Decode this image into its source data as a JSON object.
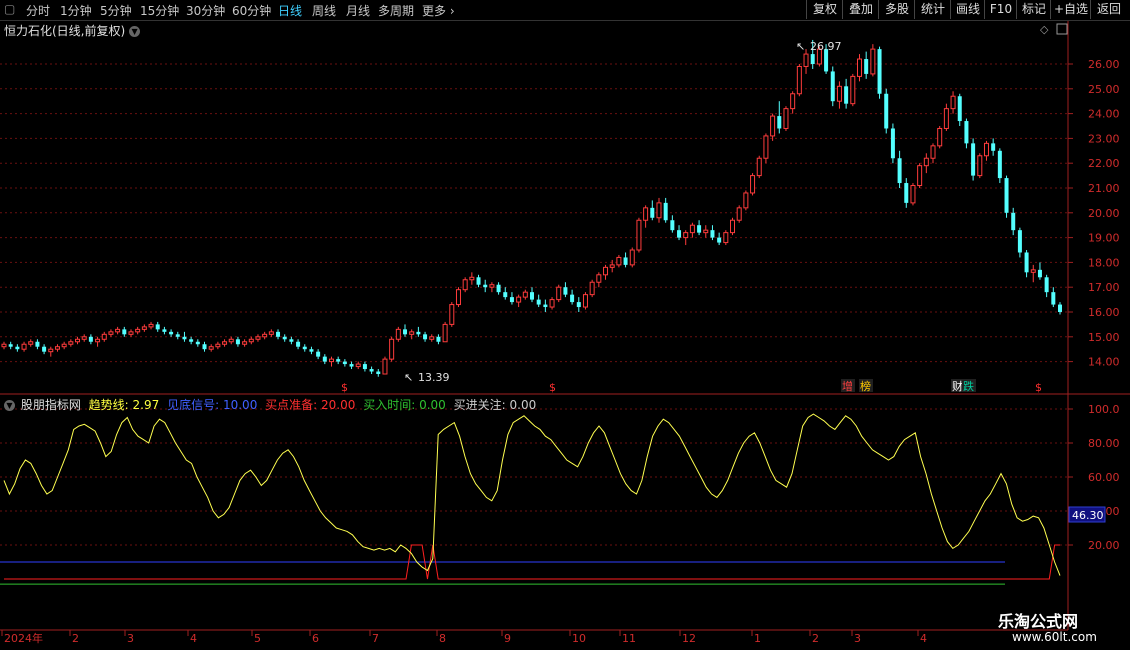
{
  "toolbar": {
    "nav_box": "▢",
    "periods": [
      "分时",
      "1分钟",
      "5分钟",
      "15分钟",
      "30分钟",
      "60分钟",
      "日线",
      "周线",
      "月线",
      "多周期",
      "更多 ›"
    ],
    "active_period": 6,
    "right_buttons": [
      "复权",
      "叠加",
      "多股",
      "统计",
      "画线",
      "F10",
      "标记",
      "+自选",
      "返回"
    ]
  },
  "main_chart": {
    "title": "恒力石化(日线,前复权)",
    "max_label": "26.97",
    "min_label": "13.39",
    "price_axis": [
      "26.00",
      "25.00",
      "24.00",
      "23.00",
      "22.00",
      "21.00",
      "20.00",
      "19.00",
      "18.00",
      "17.00",
      "16.00",
      "15.00",
      "14.00"
    ],
    "markers": [
      {
        "text": "$",
        "color": "#ff3030"
      },
      {
        "text": "$",
        "color": "#ff3030"
      },
      {
        "text": "增",
        "color": "#ff4040"
      },
      {
        "text": "榜",
        "color": "#ffcc00"
      },
      {
        "text": "财",
        "color": "#ffffff"
      },
      {
        "text": "跌",
        "color": "#00d0a0"
      },
      {
        "text": "$",
        "color": "#ff3030"
      }
    ]
  },
  "indicator": {
    "name": "股朋指标网",
    "trend": {
      "label": "趋势线:",
      "value": "2.97",
      "color": "#ffff40"
    },
    "bottom": {
      "label": "见底信号:",
      "value": "10.00",
      "color": "#4060ff"
    },
    "ready": {
      "label": "买点准备:",
      "value": "20.00",
      "color": "#ff3030"
    },
    "buy_time": {
      "label": "买入时间:",
      "value": "0.00",
      "color": "#30c030"
    },
    "attention": {
      "label": "买进关注:",
      "value": "0.00",
      "color": "#cccccc"
    },
    "axis": [
      "100.0",
      "80.00",
      "60.00",
      "40.00",
      "20.00"
    ],
    "current_value": "46.30",
    "trend_series": [
      58,
      50,
      56,
      65,
      70,
      68,
      62,
      55,
      50,
      52,
      60,
      68,
      76,
      88,
      90,
      91,
      89,
      87,
      80,
      72,
      75,
      85,
      92,
      95,
      88,
      84,
      82,
      80,
      90,
      94,
      92,
      86,
      80,
      75,
      70,
      68,
      60,
      54,
      48,
      40,
      36,
      38,
      42,
      50,
      58,
      62,
      64,
      60,
      55,
      58,
      64,
      70,
      74,
      76,
      72,
      66,
      58,
      52,
      46,
      40,
      36,
      33,
      30,
      29,
      28,
      26,
      22,
      19,
      18,
      17,
      18,
      17,
      18,
      16,
      20,
      18,
      15,
      10,
      7,
      5,
      12,
      85,
      88,
      90,
      92,
      84,
      72,
      62,
      56,
      52,
      48,
      46,
      52,
      70,
      85,
      92,
      94,
      96,
      93,
      90,
      88,
      84,
      82,
      78,
      74,
      70,
      68,
      66,
      72,
      80,
      86,
      90,
      86,
      78,
      70,
      62,
      56,
      52,
      50,
      58,
      72,
      84,
      90,
      94,
      92,
      88,
      84,
      78,
      72,
      66,
      60,
      54,
      50,
      48,
      52,
      58,
      66,
      74,
      80,
      84,
      86,
      80,
      72,
      64,
      58,
      56,
      54,
      62,
      76,
      90,
      95,
      97,
      95,
      93,
      90,
      88,
      92,
      96,
      94,
      90,
      84,
      80,
      76,
      74,
      72,
      70,
      72,
      78,
      82,
      84,
      86,
      72,
      62,
      50,
      40,
      30,
      22,
      18,
      20,
      24,
      28,
      34,
      40,
      46,
      50,
      56,
      62,
      56,
      44,
      36,
      34,
      35,
      37,
      36,
      30,
      20,
      10,
      2
    ],
    "red_step_series": [
      0,
      0,
      0,
      0,
      0,
      0,
      0,
      0,
      0,
      0,
      0,
      0,
      0,
      0,
      0,
      0,
      0,
      0,
      0,
      0,
      0,
      0,
      0,
      0,
      0,
      0,
      0,
      0,
      0,
      0,
      0,
      0,
      0,
      0,
      0,
      0,
      0,
      0,
      0,
      0,
      0,
      0,
      0,
      0,
      0,
      0,
      0,
      0,
      0,
      0,
      0,
      0,
      0,
      0,
      0,
      0,
      0,
      0,
      0,
      0,
      0,
      0,
      0,
      0,
      0,
      0,
      0,
      0,
      0,
      0,
      0,
      0,
      0,
      0,
      0,
      0,
      20,
      20,
      20,
      0,
      20,
      0,
      0,
      0,
      0,
      0,
      0,
      0,
      0,
      0,
      0,
      0,
      0,
      0,
      0,
      0,
      0,
      0,
      0,
      0,
      0,
      0,
      0,
      0,
      0,
      0,
      0,
      0,
      0,
      0,
      0,
      0,
      0,
      0,
      0,
      0,
      0,
      0,
      0,
      0,
      0,
      0,
      0,
      0,
      0,
      0,
      0,
      0,
      0,
      0,
      0,
      0,
      0,
      0,
      0,
      0,
      0,
      0,
      0,
      0,
      0,
      0,
      0,
      0,
      0,
      0,
      0,
      0,
      0,
      0,
      0,
      0,
      0,
      0,
      0,
      0,
      0,
      0,
      0,
      0,
      0,
      0,
      0,
      0,
      0,
      0,
      0,
      0,
      0,
      0,
      0,
      0,
      0,
      0,
      0,
      0,
      0,
      0,
      0,
      0,
      0,
      0,
      0,
      0,
      0,
      0,
      0,
      0,
      0,
      0,
      0,
      0,
      0,
      0,
      0,
      0,
      20,
      20
    ]
  },
  "xaxis": [
    "2024年",
    "2",
    "3",
    "4",
    "5",
    "6",
    "7",
    "8",
    "9",
    "10",
    "11",
    "12",
    "1",
    "2",
    "3",
    "4"
  ],
  "candles": [
    [
      14.6,
      14.8,
      14.5,
      14.7
    ],
    [
      14.7,
      14.8,
      14.5,
      14.6
    ],
    [
      14.6,
      14.7,
      14.4,
      14.5
    ],
    [
      14.5,
      14.8,
      14.4,
      14.7
    ],
    [
      14.7,
      14.9,
      14.6,
      14.8
    ],
    [
      14.8,
      14.9,
      14.5,
      14.6
    ],
    [
      14.6,
      14.7,
      14.3,
      14.4
    ],
    [
      14.4,
      14.6,
      14.2,
      14.5
    ],
    [
      14.5,
      14.7,
      14.4,
      14.6
    ],
    [
      14.6,
      14.8,
      14.5,
      14.7
    ],
    [
      14.7,
      14.9,
      14.6,
      14.8
    ],
    [
      14.8,
      15.0,
      14.7,
      14.9
    ],
    [
      14.9,
      15.1,
      14.8,
      15.0
    ],
    [
      15.0,
      15.1,
      14.7,
      14.8
    ],
    [
      14.8,
      15.0,
      14.6,
      14.9
    ],
    [
      14.9,
      15.2,
      14.8,
      15.1
    ],
    [
      15.1,
      15.3,
      15.0,
      15.2
    ],
    [
      15.2,
      15.4,
      15.1,
      15.3
    ],
    [
      15.3,
      15.4,
      15.0,
      15.1
    ],
    [
      15.1,
      15.3,
      15.0,
      15.2
    ],
    [
      15.2,
      15.4,
      15.1,
      15.3
    ],
    [
      15.3,
      15.5,
      15.2,
      15.4
    ],
    [
      15.4,
      15.6,
      15.3,
      15.5
    ],
    [
      15.5,
      15.6,
      15.2,
      15.3
    ],
    [
      15.3,
      15.4,
      15.1,
      15.2
    ],
    [
      15.2,
      15.3,
      15.0,
      15.1
    ],
    [
      15.1,
      15.2,
      14.9,
      15.0
    ],
    [
      15.0,
      15.2,
      14.8,
      14.9
    ],
    [
      14.9,
      15.0,
      14.7,
      14.8
    ],
    [
      14.8,
      14.9,
      14.6,
      14.7
    ],
    [
      14.7,
      14.8,
      14.4,
      14.5
    ],
    [
      14.5,
      14.7,
      14.4,
      14.6
    ],
    [
      14.6,
      14.8,
      14.5,
      14.7
    ],
    [
      14.7,
      14.9,
      14.6,
      14.8
    ],
    [
      14.8,
      15.0,
      14.7,
      14.9
    ],
    [
      14.9,
      15.0,
      14.6,
      14.7
    ],
    [
      14.7,
      14.9,
      14.6,
      14.8
    ],
    [
      14.8,
      15.0,
      14.7,
      14.9
    ],
    [
      14.9,
      15.1,
      14.8,
      15.0
    ],
    [
      15.0,
      15.2,
      14.9,
      15.1
    ],
    [
      15.1,
      15.3,
      15.0,
      15.2
    ],
    [
      15.2,
      15.3,
      14.9,
      15.0
    ],
    [
      15.0,
      15.1,
      14.8,
      14.9
    ],
    [
      14.9,
      15.0,
      14.7,
      14.8
    ],
    [
      14.8,
      14.9,
      14.5,
      14.6
    ],
    [
      14.6,
      14.7,
      14.4,
      14.5
    ],
    [
      14.5,
      14.6,
      14.3,
      14.4
    ],
    [
      14.4,
      14.5,
      14.1,
      14.2
    ],
    [
      14.2,
      14.3,
      13.9,
      14.0
    ],
    [
      14.0,
      14.2,
      13.8,
      14.1
    ],
    [
      14.1,
      14.2,
      13.9,
      14.0
    ],
    [
      14.0,
      14.1,
      13.8,
      13.9
    ],
    [
      13.9,
      14.0,
      13.7,
      13.8
    ],
    [
      13.8,
      14.0,
      13.7,
      13.9
    ],
    [
      13.9,
      14.0,
      13.6,
      13.7
    ],
    [
      13.7,
      13.8,
      13.5,
      13.6
    ],
    [
      13.6,
      13.7,
      13.39,
      13.5
    ],
    [
      13.5,
      14.2,
      13.5,
      14.1
    ],
    [
      14.1,
      15.0,
      14.0,
      14.9
    ],
    [
      14.9,
      15.4,
      14.8,
      15.3
    ],
    [
      15.3,
      15.5,
      15.0,
      15.1
    ],
    [
      15.1,
      15.3,
      14.9,
      15.2
    ],
    [
      15.2,
      15.4,
      15.0,
      15.1
    ],
    [
      15.1,
      15.2,
      14.8,
      14.9
    ],
    [
      14.9,
      15.1,
      14.8,
      15.0
    ],
    [
      15.0,
      15.1,
      14.7,
      14.8
    ],
    [
      14.8,
      15.6,
      14.8,
      15.5
    ],
    [
      15.5,
      16.4,
      15.4,
      16.3
    ],
    [
      16.3,
      17.0,
      16.2,
      16.9
    ],
    [
      16.9,
      17.4,
      16.8,
      17.3
    ],
    [
      17.3,
      17.6,
      17.1,
      17.4
    ],
    [
      17.4,
      17.5,
      17.0,
      17.1
    ],
    [
      17.1,
      17.3,
      16.8,
      17.0
    ],
    [
      17.0,
      17.2,
      16.8,
      17.1
    ],
    [
      17.1,
      17.2,
      16.7,
      16.8
    ],
    [
      16.8,
      17.0,
      16.5,
      16.6
    ],
    [
      16.6,
      16.8,
      16.3,
      16.4
    ],
    [
      16.4,
      16.7,
      16.2,
      16.6
    ],
    [
      16.6,
      16.9,
      16.5,
      16.8
    ],
    [
      16.8,
      17.0,
      16.4,
      16.5
    ],
    [
      16.5,
      16.7,
      16.2,
      16.3
    ],
    [
      16.3,
      16.5,
      16.0,
      16.2
    ],
    [
      16.2,
      16.6,
      16.1,
      16.5
    ],
    [
      16.5,
      17.1,
      16.4,
      17.0
    ],
    [
      17.0,
      17.2,
      16.6,
      16.7
    ],
    [
      16.7,
      16.9,
      16.3,
      16.4
    ],
    [
      16.4,
      16.6,
      16.0,
      16.2
    ],
    [
      16.2,
      16.8,
      16.1,
      16.7
    ],
    [
      16.7,
      17.3,
      16.6,
      17.2
    ],
    [
      17.2,
      17.6,
      17.0,
      17.5
    ],
    [
      17.5,
      17.9,
      17.3,
      17.8
    ],
    [
      17.8,
      18.1,
      17.6,
      17.9
    ],
    [
      17.9,
      18.3,
      17.8,
      18.2
    ],
    [
      18.2,
      18.4,
      17.8,
      17.9
    ],
    [
      17.9,
      18.6,
      17.8,
      18.5
    ],
    [
      18.5,
      19.8,
      18.4,
      19.7
    ],
    [
      19.7,
      20.3,
      19.4,
      20.2
    ],
    [
      20.2,
      20.5,
      19.7,
      19.8
    ],
    [
      19.8,
      20.6,
      19.6,
      20.4
    ],
    [
      20.4,
      20.6,
      19.6,
      19.7
    ],
    [
      19.7,
      19.9,
      19.2,
      19.3
    ],
    [
      19.3,
      19.5,
      18.9,
      19.0
    ],
    [
      19.0,
      19.3,
      18.7,
      19.2
    ],
    [
      19.2,
      19.6,
      19.0,
      19.5
    ],
    [
      19.5,
      19.7,
      19.1,
      19.2
    ],
    [
      19.2,
      19.5,
      19.0,
      19.3
    ],
    [
      19.3,
      19.5,
      18.9,
      19.0
    ],
    [
      19.0,
      19.2,
      18.7,
      18.8
    ],
    [
      18.8,
      19.3,
      18.7,
      19.2
    ],
    [
      19.2,
      19.8,
      19.1,
      19.7
    ],
    [
      19.7,
      20.3,
      19.6,
      20.2
    ],
    [
      20.2,
      20.9,
      20.1,
      20.8
    ],
    [
      20.8,
      21.6,
      20.7,
      21.5
    ],
    [
      21.5,
      22.3,
      21.4,
      22.2
    ],
    [
      22.2,
      23.2,
      22.0,
      23.1
    ],
    [
      23.1,
      24.0,
      22.9,
      23.9
    ],
    [
      23.9,
      24.5,
      23.2,
      23.4
    ],
    [
      23.4,
      24.3,
      23.3,
      24.2
    ],
    [
      24.2,
      24.9,
      24.0,
      24.8
    ],
    [
      24.8,
      26.0,
      24.7,
      25.9
    ],
    [
      25.9,
      26.6,
      25.6,
      26.4
    ],
    [
      26.4,
      26.97,
      25.8,
      26.0
    ],
    [
      26.0,
      26.7,
      25.9,
      26.6
    ],
    [
      26.6,
      26.8,
      25.6,
      25.7
    ],
    [
      25.7,
      25.9,
      24.3,
      24.5
    ],
    [
      24.5,
      25.3,
      24.2,
      25.1
    ],
    [
      25.1,
      25.4,
      24.2,
      24.4
    ],
    [
      24.4,
      25.6,
      24.3,
      25.5
    ],
    [
      25.5,
      26.4,
      25.3,
      26.2
    ],
    [
      26.2,
      26.5,
      25.4,
      25.6
    ],
    [
      25.6,
      26.8,
      25.5,
      26.6
    ],
    [
      26.6,
      26.7,
      24.6,
      24.8
    ],
    [
      24.8,
      25.0,
      23.2,
      23.4
    ],
    [
      23.4,
      23.6,
      22.0,
      22.2
    ],
    [
      22.2,
      22.5,
      21.0,
      21.2
    ],
    [
      21.2,
      21.4,
      20.2,
      20.4
    ],
    [
      20.4,
      21.2,
      20.3,
      21.1
    ],
    [
      21.1,
      22.0,
      21.0,
      21.9
    ],
    [
      21.9,
      22.4,
      21.6,
      22.2
    ],
    [
      22.2,
      22.8,
      22.0,
      22.7
    ],
    [
      22.7,
      23.5,
      22.6,
      23.4
    ],
    [
      23.4,
      24.4,
      23.3,
      24.2
    ],
    [
      24.2,
      24.9,
      24.0,
      24.7
    ],
    [
      24.7,
      24.8,
      23.5,
      23.7
    ],
    [
      23.7,
      23.8,
      22.6,
      22.8
    ],
    [
      22.8,
      23.0,
      21.3,
      21.5
    ],
    [
      21.5,
      22.4,
      21.4,
      22.3
    ],
    [
      22.3,
      22.9,
      22.1,
      22.8
    ],
    [
      22.8,
      23.0,
      22.3,
      22.5
    ],
    [
      22.5,
      22.6,
      21.2,
      21.4
    ],
    [
      21.4,
      21.5,
      19.8,
      20.0
    ],
    [
      20.0,
      20.2,
      19.1,
      19.3
    ],
    [
      19.3,
      19.4,
      18.2,
      18.4
    ],
    [
      18.4,
      18.5,
      17.4,
      17.6
    ],
    [
      17.6,
      17.9,
      17.2,
      17.7
    ],
    [
      17.7,
      18.0,
      17.3,
      17.4
    ],
    [
      17.4,
      17.5,
      16.6,
      16.8
    ],
    [
      16.8,
      17.0,
      16.2,
      16.3
    ],
    [
      16.3,
      16.4,
      15.9,
      16.0
    ]
  ]
}
